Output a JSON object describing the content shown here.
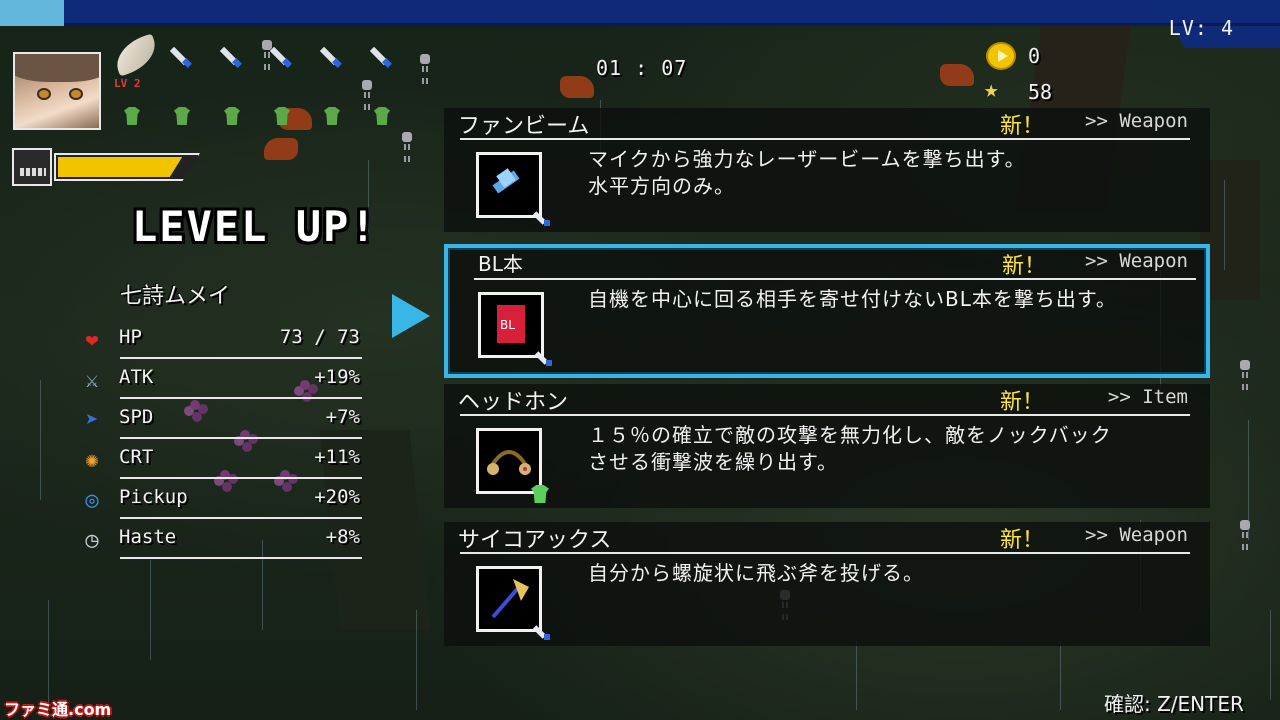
{
  "hud": {
    "player_level": "LV: 4",
    "timer": "01 : 07",
    "coins": "0",
    "stars": "58",
    "weapon_level_badge": "LV 2",
    "xp_fraction": 0.05,
    "hp_bar_fraction": 0.9
  },
  "level_up": {
    "title": "LEVEL UP!",
    "character_name": "七詩ムメイ",
    "stats": [
      {
        "name": "HP",
        "value": "73 / 73",
        "icon": "heart-icon"
      },
      {
        "name": "ATK",
        "value": "+19%",
        "icon": "sword-icon"
      },
      {
        "name": "SPD",
        "value": "+7%",
        "icon": "boot-icon"
      },
      {
        "name": "CRT",
        "value": "+11%",
        "icon": "crit-icon"
      },
      {
        "name": "Pickup",
        "value": "+20%",
        "icon": "magnet-ring-icon"
      },
      {
        "name": "Haste",
        "value": "+8%",
        "icon": "clock-icon"
      }
    ]
  },
  "options": [
    {
      "name": "ファンビーム",
      "new_label": "新！",
      "type": ">> Weapon",
      "description": "マイクから強力なレーザービームを撃ち出す。\n水平方向のみ。",
      "icon": "microphone-beam-icon"
    },
    {
      "name": "BL本",
      "new_label": "新！",
      "type": ">> Weapon",
      "description": "自機を中心に回る相手を寄せ付けないBL本を撃ち出す。",
      "icon": "bl-book-icon"
    },
    {
      "name": "ヘッドホン",
      "new_label": "新！",
      "type": ">> Item",
      "description": "１５％の確立で敵の攻撃を無力化し、敵をノックバック\nさせる衝撃波を繰り出す。",
      "icon": "headphones-icon"
    },
    {
      "name": "サイコアックス",
      "new_label": "新！",
      "type": ">> Weapon",
      "description": "自分から螺旋状に飛ぶ斧を投げる。",
      "icon": "axe-icon"
    }
  ],
  "selected_option_index": 1,
  "footer": {
    "confirm_hint": "確認: Z/ENTER",
    "watermark": "ファミ通.com"
  },
  "colors": {
    "accent_selection": "#38b6e6",
    "new_label": "#ffe63b",
    "hp_bar": "#f2c400",
    "xp_bar_bg": "#0f2a78",
    "xp_bar_fill": "#63b7dd"
  }
}
